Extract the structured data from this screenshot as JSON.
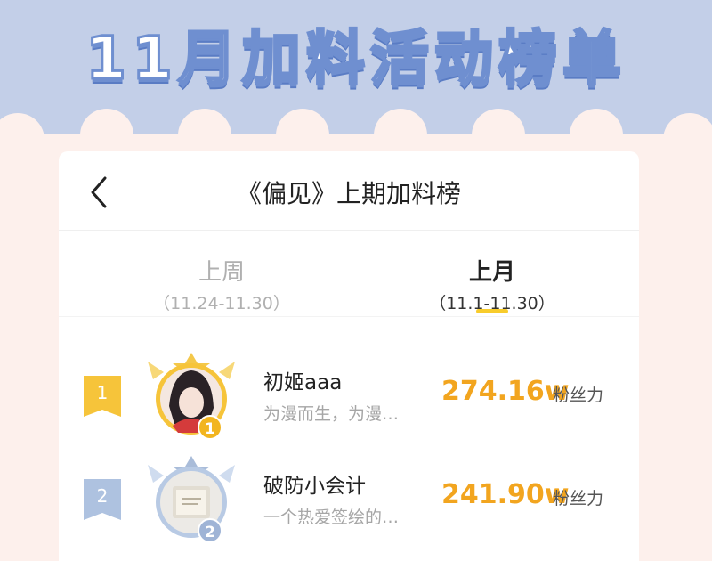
{
  "banner": {
    "title": "11月加料活动榜单"
  },
  "colors": {
    "banner_bg": "#c3cfe8",
    "page_bg": "#fdf0ec",
    "accent_gold": "#f2a51f",
    "tab_indicator": "#f8cc2c",
    "rank1_badge": "#f6c43a",
    "rank2_badge": "#aec2e0"
  },
  "header": {
    "back_icon": "chevron-left-icon",
    "title": "《偏见》上期加料榜"
  },
  "tabs": [
    {
      "label": "上周",
      "range": "（11.24-11.30）",
      "active": false
    },
    {
      "label": "上月",
      "range": "（11.1-11.30）",
      "active": true
    }
  ],
  "rankings": [
    {
      "rank": "1",
      "name": "初姬aaa",
      "bio": "为漫而生，为漫…",
      "score": "274.16w",
      "unit": "粉丝力",
      "avatar_icon": "avatar-gold-frame-icon"
    },
    {
      "rank": "2",
      "name": "破防小会计",
      "bio": "一个热爱签绘的…",
      "score": "241.90w",
      "unit": "粉丝力",
      "avatar_icon": "avatar-silver-frame-icon"
    }
  ]
}
